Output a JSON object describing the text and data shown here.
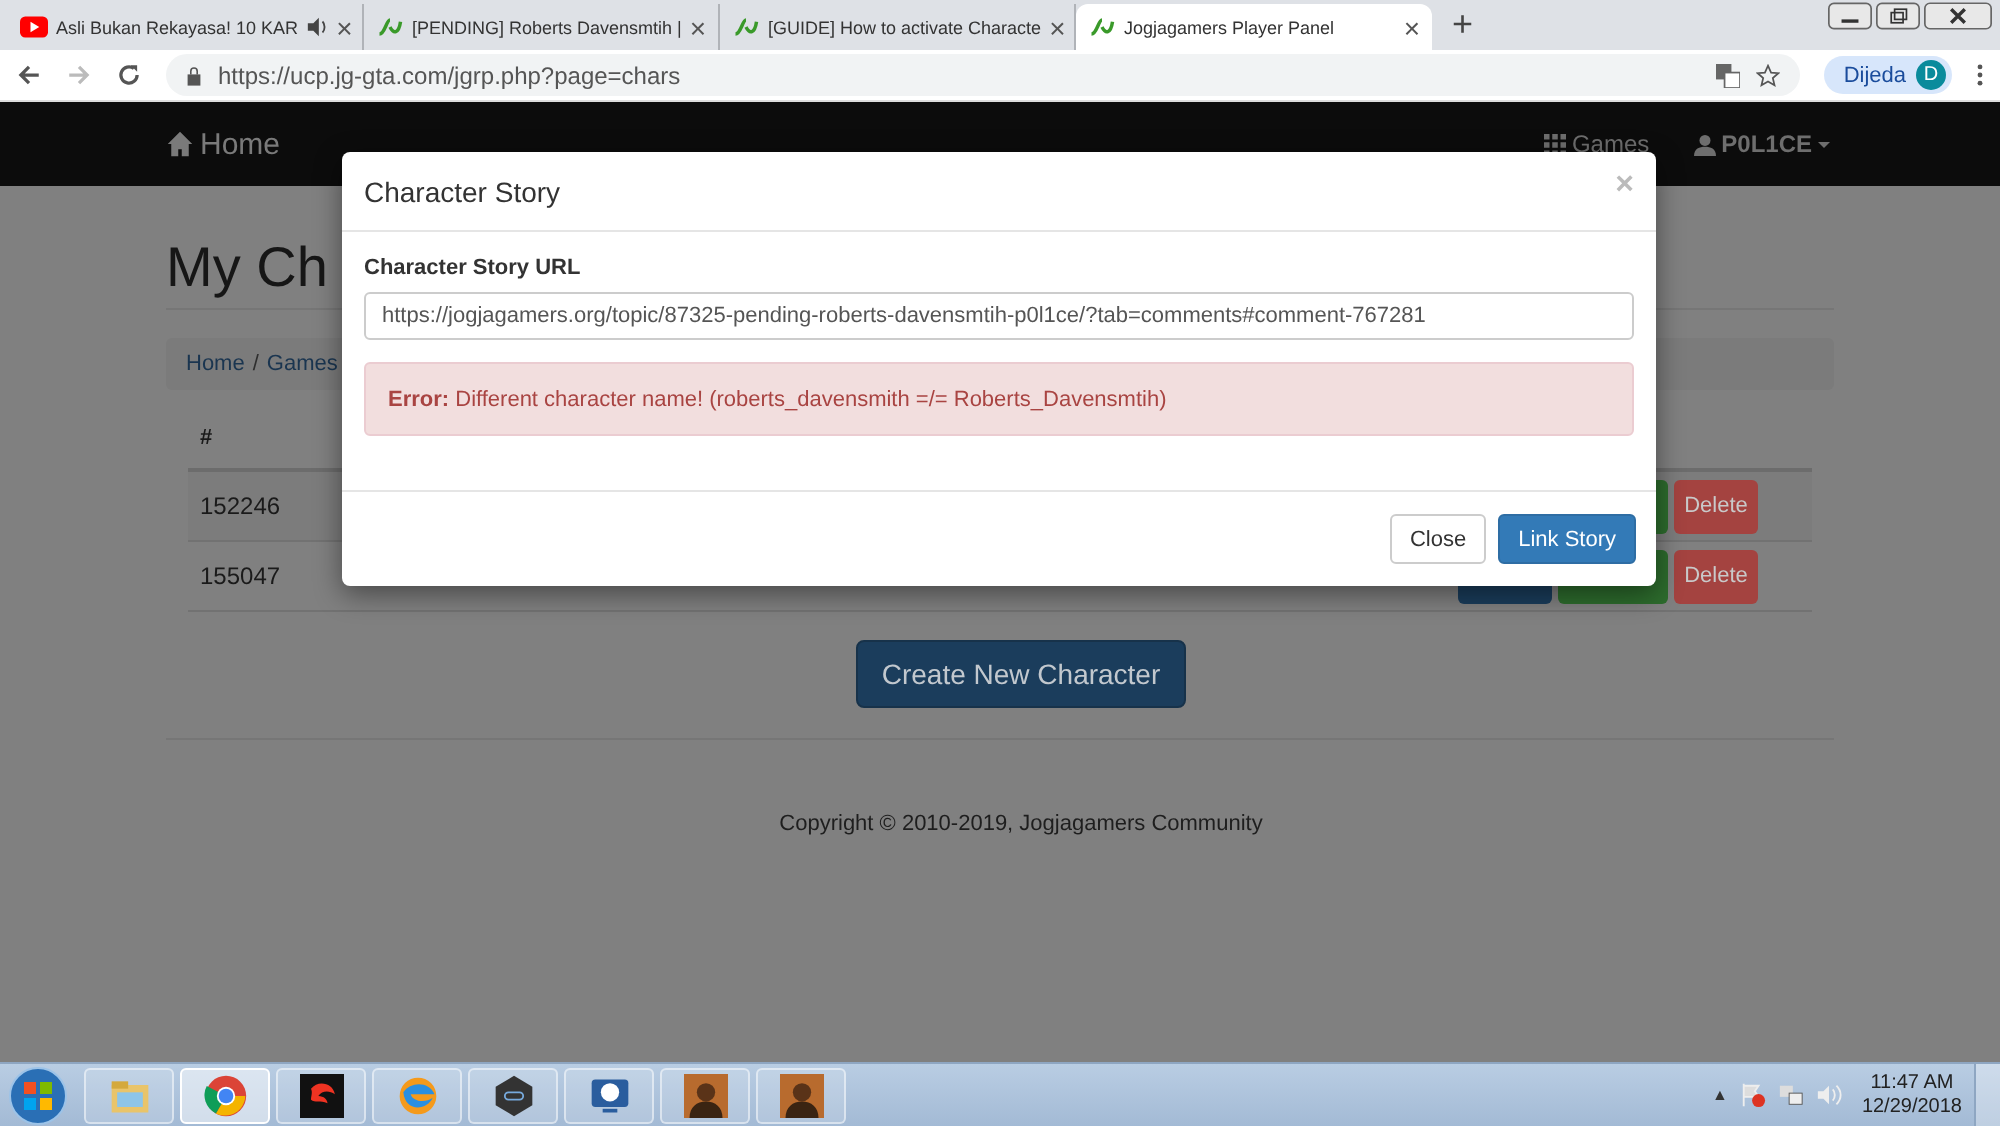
{
  "browser": {
    "tabs": [
      {
        "title": "Asli Bukan Rekayasa! 10 KAR",
        "kind": "video",
        "audio": true,
        "selected": false
      },
      {
        "title": "[PENDING] Roberts Davensmtih |",
        "kind": "site",
        "audio": false,
        "selected": false
      },
      {
        "title": "[GUIDE] How to activate Characte",
        "kind": "site",
        "audio": false,
        "selected": false
      },
      {
        "title": "Jogjagamers Player Panel",
        "kind": "site",
        "audio": false,
        "selected": true
      }
    ],
    "new_tab": "+",
    "close": "×",
    "url": "https://ucp.jg-gta.com/jgrp.php?page=chars",
    "profile": {
      "name": "Dijeda",
      "initial": "D"
    }
  },
  "navbar": {
    "brand": "Home",
    "items": [
      {
        "label": "Games",
        "kind": "games",
        "dropdown": false
      },
      {
        "label": "P0L1CE",
        "kind": "user",
        "dropdown": true
      }
    ]
  },
  "page": {
    "title": "My Ch",
    "breadcrumb": [
      "Home",
      "Games"
    ],
    "breadcrumb_separator": "/",
    "table": {
      "header": "#",
      "rows": [
        {
          "id": "152246",
          "actions": [
            {
              "kind": "success"
            },
            {
              "kind": "danger",
              "label": "Delete"
            }
          ]
        },
        {
          "id": "155047",
          "actions": [
            {
              "kind": "primary"
            },
            {
              "kind": "success"
            },
            {
              "kind": "danger",
              "label": "Delete"
            }
          ]
        }
      ]
    },
    "create_button": "Create New Character",
    "copyright": "Copyright © 2010-2019, Jogjagamers Community"
  },
  "modal": {
    "title": "Character Story",
    "close": "×",
    "label": "Character Story URL",
    "value": "https://jogjagamers.org/topic/87325-pending-roberts-davensmtih-p0l1ce/?tab=comments#comment-767281",
    "alert": "**Error:** Different character name! (roberts_davensmith =/= Roberts_Davensmtih)",
    "buttons": [
      {
        "label": "Close",
        "kind": "default"
      },
      {
        "label": "Link Story",
        "kind": "primary"
      }
    ]
  },
  "taskbar": {
    "apps": [
      {
        "kind": "folder",
        "selected": false
      },
      {
        "kind": "chrome",
        "selected": true
      },
      {
        "kind": "game",
        "selected": false
      },
      {
        "kind": "browser",
        "selected": false
      },
      {
        "kind": "emulator",
        "selected": false
      },
      {
        "kind": "screen",
        "selected": false
      },
      {
        "kind": "portrait",
        "selected": false
      },
      {
        "kind": "portrait",
        "selected": false
      }
    ],
    "tray_arrow": "▲",
    "time": "11:47 AM",
    "date": "12/29/2018"
  }
}
